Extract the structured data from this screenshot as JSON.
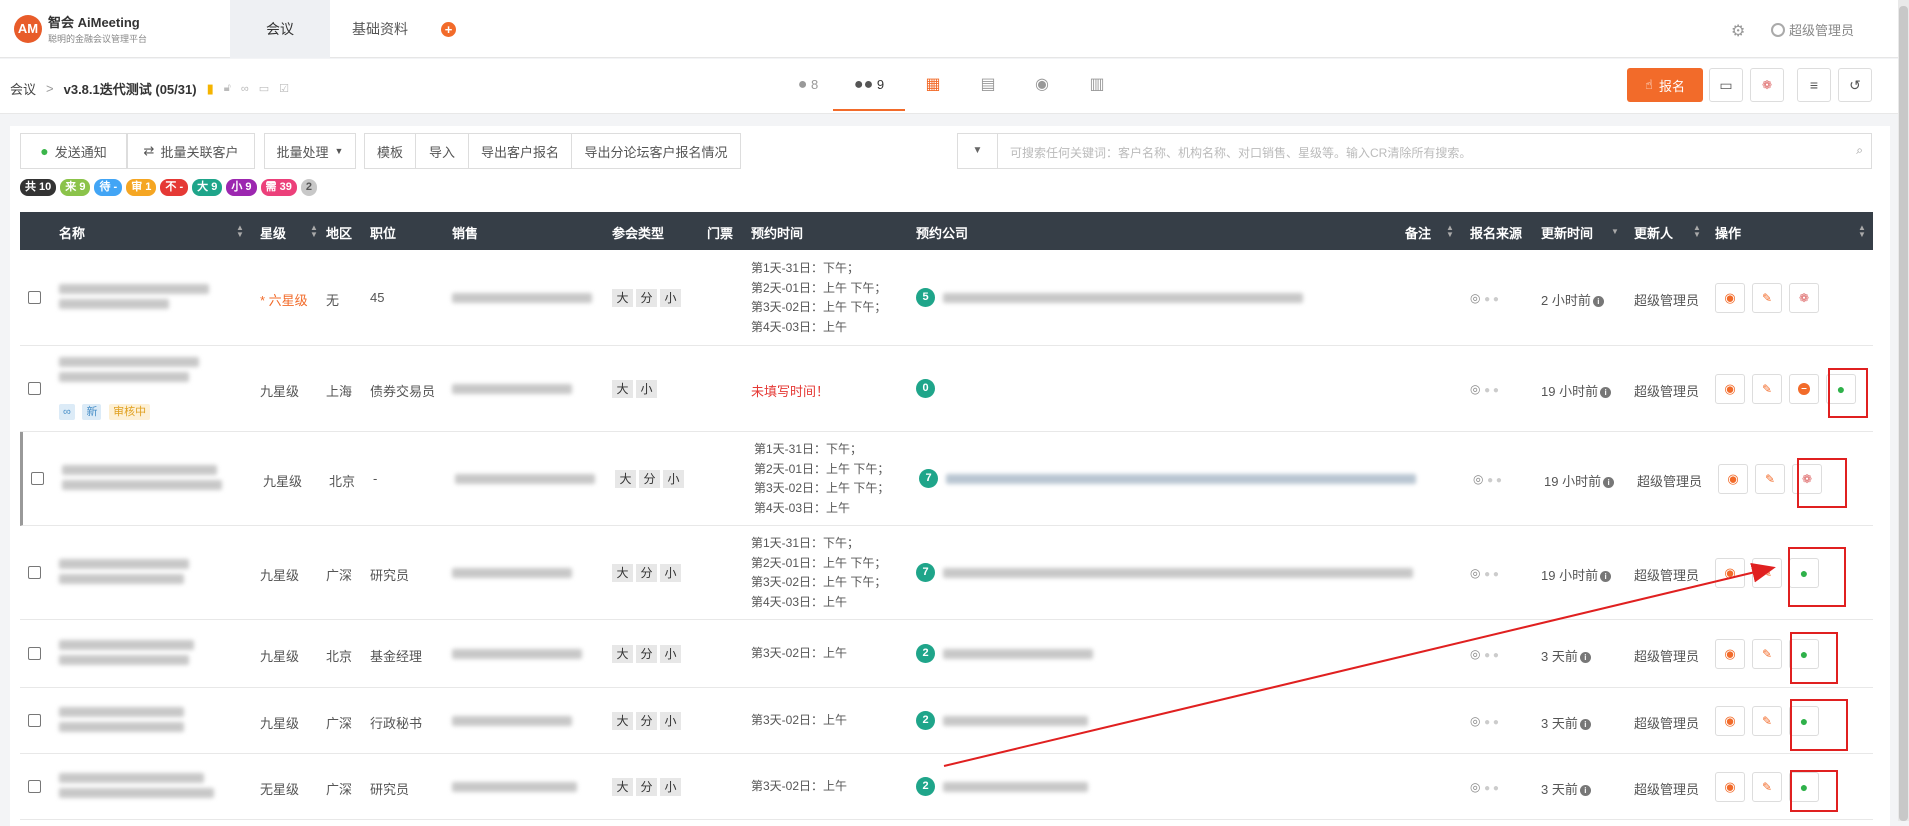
{
  "header": {
    "brand": "智会 AiMeeting",
    "brand_sub": "聪明的金融会议管理平台",
    "logo_mark": "AM",
    "tabs": [
      "会议",
      "基础资料"
    ],
    "plus": "+",
    "user": "超级管理员"
  },
  "breadcrumb": {
    "root": "会议",
    "sep": ">",
    "title": "v3.8.1迭代测试 (05/31)"
  },
  "center_tabs": [
    {
      "icon": "person-icon",
      "count": "8"
    },
    {
      "icon": "group-icon",
      "count": "9"
    },
    {
      "icon": "calendar-icon"
    },
    {
      "icon": "document-icon"
    },
    {
      "icon": "location-icon"
    },
    {
      "icon": "chart-icon"
    }
  ],
  "buttons": {
    "signup": "报名"
  },
  "toolbar": {
    "notify": "发送通知",
    "batch_link": "批量关联客户",
    "batch_process": "批量处理",
    "template": "模板",
    "import": "导入",
    "export_signup": "导出客户报名",
    "export_forum": "导出分论坛客户报名情况"
  },
  "search": {
    "placeholder": "可搜索任何关键词：客户名称、机构名称、对口销售、星级等。输入CR清除所有搜索。"
  },
  "chips": [
    {
      "label": "共 10",
      "color": "#333333"
    },
    {
      "label": "来 9",
      "color": "#8bc34a"
    },
    {
      "label": "待 -",
      "color": "#42a5f5"
    },
    {
      "label": "审 1",
      "color": "#f5a623"
    },
    {
      "label": "不 -",
      "color": "#e53935"
    },
    {
      "label": "大 9",
      "color": "#1fa58a"
    },
    {
      "label": "小 9",
      "color": "#9c27b0"
    },
    {
      "label": "需 39",
      "color": "#ec407a"
    },
    {
      "label": "2",
      "color": "#c8c8c8"
    }
  ],
  "columns": [
    "名称",
    "星级",
    "地区",
    "职位",
    "销售",
    "参会类型",
    "门票",
    "预约时间",
    "预约公司",
    "备注",
    "报名来源",
    "更新时间",
    "更新人",
    "操作"
  ],
  "rows": [
    {
      "star": "* 六星级",
      "region": "无",
      "position": "45",
      "types": [
        "大",
        "分",
        "小"
      ],
      "schedule": [
        "第1天-31日：下午；",
        "第2天-01日：上午 下午；",
        "第3天-02日：上午 下午；",
        "第4天-03日：上午"
      ],
      "count": "5",
      "updated": "2 小时前",
      "updater": "超级管理员"
    },
    {
      "star": "九星级",
      "region": "上海",
      "position": "债券交易员",
      "types": [
        "大",
        "小"
      ],
      "schedule_missing": "未填写时间！",
      "tags": [
        "新",
        "审核中"
      ],
      "count": "0",
      "updated": "19 小时前",
      "updater": "超级管理员"
    },
    {
      "star": "九星级",
      "region": "北京",
      "position": "-",
      "types": [
        "大",
        "分",
        "小"
      ],
      "schedule": [
        "第1天-31日：下午；",
        "第2天-01日：上午 下午；",
        "第3天-02日：上午 下午；",
        "第4天-03日：上午"
      ],
      "count": "7",
      "updated": "19 小时前",
      "updater": "超级管理员"
    },
    {
      "star": "九星级",
      "region": "广深",
      "position": "研究员",
      "types": [
        "大",
        "分",
        "小"
      ],
      "schedule": [
        "第1天-31日：下午；",
        "第2天-01日：上午 下午；",
        "第3天-02日：上午 下午；",
        "第4天-03日：上午"
      ],
      "count": "7",
      "updated": "19 小时前",
      "updater": "超级管理员"
    },
    {
      "star": "九星级",
      "region": "北京",
      "position": "基金经理",
      "types": [
        "大",
        "分",
        "小"
      ],
      "schedule": [
        "第3天-02日：上午"
      ],
      "count": "2",
      "updated": "3 天前",
      "updater": "超级管理员"
    },
    {
      "star": "九星级",
      "region": "广深",
      "position": "行政秘书",
      "types": [
        "大",
        "分",
        "小"
      ],
      "schedule": [
        "第3天-02日：上午"
      ],
      "count": "2",
      "updated": "3 天前",
      "updater": "超级管理员"
    },
    {
      "star": "无星级",
      "region": "广深",
      "position": "研究员",
      "types": [
        "大",
        "分",
        "小"
      ],
      "schedule": [
        "第3天-02日：上午"
      ],
      "count": "2",
      "updated": "3 天前",
      "updater": "超级管理员"
    }
  ]
}
